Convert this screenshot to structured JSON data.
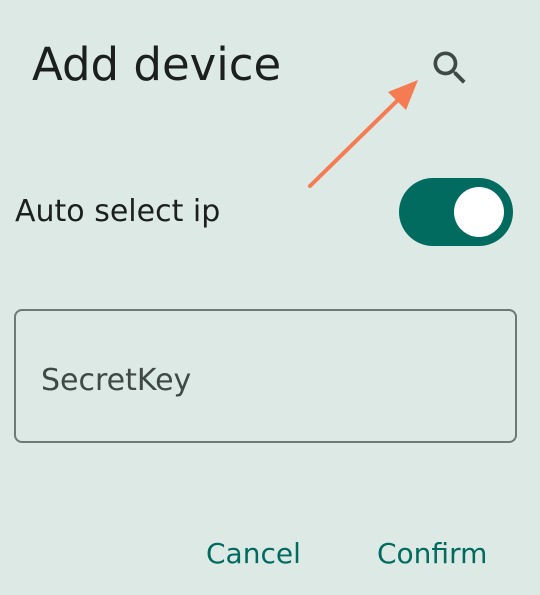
{
  "dialog": {
    "title": "Add device",
    "search_icon": "search-icon",
    "auto_select": {
      "label": "Auto select ip",
      "enabled": true
    },
    "secret_field": {
      "placeholder": "SecretKey",
      "value": ""
    },
    "actions": {
      "cancel_label": "Cancel",
      "confirm_label": "Confirm"
    }
  },
  "colors": {
    "background": "#dde9e5",
    "accent": "#006b5e",
    "annotation_arrow": "#f47b52",
    "text": "#1b1f1e",
    "outline": "#6f7976"
  }
}
